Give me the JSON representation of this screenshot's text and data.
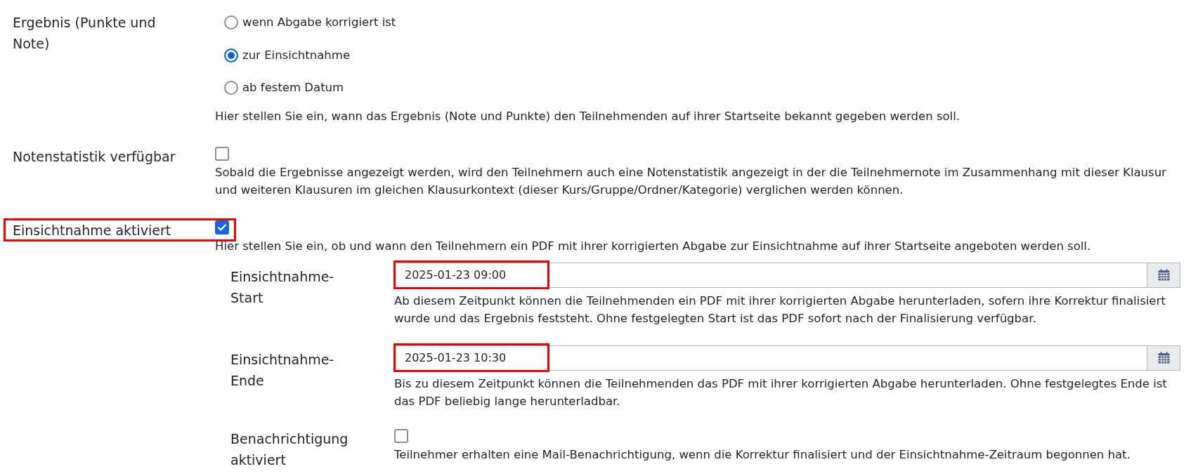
{
  "settings": [
    {
      "kind": "radio_group",
      "label": "Ergebnis (Punkte und Note)",
      "highlighted": false,
      "options": [
        {
          "label": "wenn Abgabe korrigiert ist",
          "selected": false
        },
        {
          "label": "zur Einsichtnahme",
          "selected": true
        },
        {
          "label": "ab festem Datum",
          "selected": false
        }
      ],
      "help": "Hier stellen Sie ein, wann das Ergebnis (Note und Punkte) den Teilnehmenden auf ihrer Startseite bekannt gegeben werden soll."
    },
    {
      "kind": "checkbox",
      "label": "Notenstatistik verfügbar",
      "checked": false,
      "highlighted": false,
      "help": "Sobald die Ergebnisse angezeigt werden, wird den Teilnehmern auch eine Notenstatistik angezeigt in der die Teilnehmernote im Zusammenhang mit dieser Klausur und weiteren Klausuren im gleichen Klausurkontext (dieser Kurs/Gruppe/Ordner/Kategorie) verglichen werden können."
    },
    {
      "kind": "checkbox",
      "label": "Einsichtnahme aktiviert",
      "checked": true,
      "highlighted": true,
      "help": "Hier stellen Sie ein, ob und wann den Teilnehmern ein PDF mit ihrer korrigierten Abgabe zur Einsichtnahme auf ihrer Startseite angeboten werden soll.",
      "sub_settings": [
        {
          "kind": "datetime",
          "label": "Einsichtnahme-Start",
          "value": "2025-01-23 09:00",
          "highlighted": true,
          "help": "Ab diesem Zeitpunkt können die Teilnehmenden ein PDF mit ihrer korrigierten Abgabe herunterladen, sofern ihre Korrektur finalisiert wurde und das Ergebnis feststeht. Ohne festgelegten Start ist das PDF sofort nach der Finalisierung verfügbar."
        },
        {
          "kind": "datetime",
          "label": "Einsichtnahme-Ende",
          "value": "2025-01-23 10:30",
          "highlighted": true,
          "help": "Bis zu diesem Zeitpunkt können die Teilnehmenden das PDF mit ihrer korrigierten Abgabe herunterladen. Ohne festgelegtes Ende ist das PDF beliebig lange herunterladbar."
        },
        {
          "kind": "checkbox",
          "label": "Benachrichtigung aktiviert",
          "checked": false,
          "highlighted": false,
          "help": "Teilnehmer erhalten eine Mail-Benachrichtigung, wenn die Korrektur finalisiert und der Einsichtnahme-Zeitraum begonnen hat."
        }
      ]
    }
  ]
}
